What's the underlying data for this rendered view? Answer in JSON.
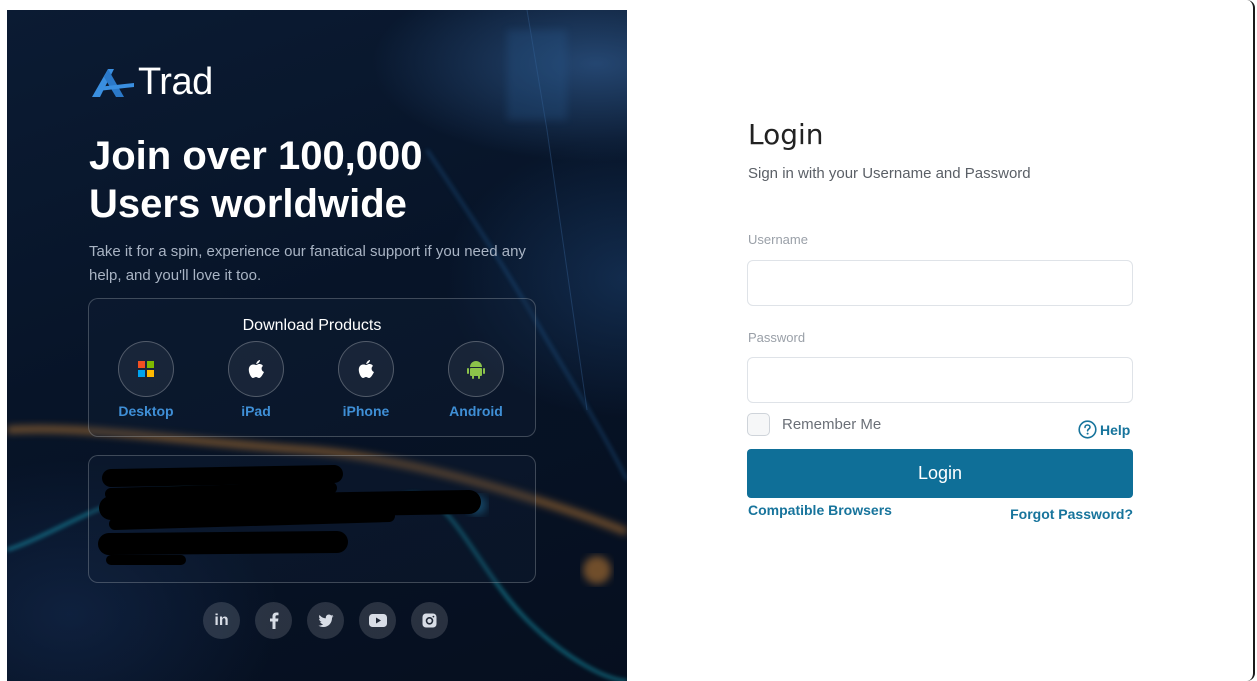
{
  "brand": {
    "logo_text": "Trad",
    "logo_icon": "atrad-a-logo-icon",
    "accent": "#3a8fe0"
  },
  "hero": {
    "headline_line1": "Join over 100,000",
    "headline_line2": "Users worldwide",
    "subtext": "Take it for a spin, experience our fanatical support if you need any help, and you'll love it too."
  },
  "downloads": {
    "title": "Download Products",
    "items": [
      {
        "label": "Desktop",
        "icon": "windows-icon"
      },
      {
        "label": "iPad",
        "icon": "apple-icon"
      },
      {
        "label": "iPhone",
        "icon": "apple-icon"
      },
      {
        "label": "Android",
        "icon": "android-icon"
      }
    ]
  },
  "socials": [
    {
      "name": "linkedin",
      "icon": "linkedin-icon",
      "text": "in"
    },
    {
      "name": "facebook",
      "icon": "facebook-icon"
    },
    {
      "name": "twitter",
      "icon": "twitter-icon"
    },
    {
      "name": "youtube",
      "icon": "youtube-icon"
    },
    {
      "name": "instagram",
      "icon": "instagram-icon"
    }
  ],
  "login": {
    "title": "Login",
    "subtitle": "Sign in with your Username and Password",
    "username_label": "Username",
    "username_value": "",
    "password_label": "Password",
    "password_value": "",
    "remember_label": "Remember Me",
    "remember_checked": false,
    "help_label": "Help",
    "submit_label": "Login",
    "compatible_label": "Compatible Browsers",
    "forgot_label": "Forgot Password?",
    "button_color": "#0f6f98",
    "link_color": "#17749c"
  }
}
